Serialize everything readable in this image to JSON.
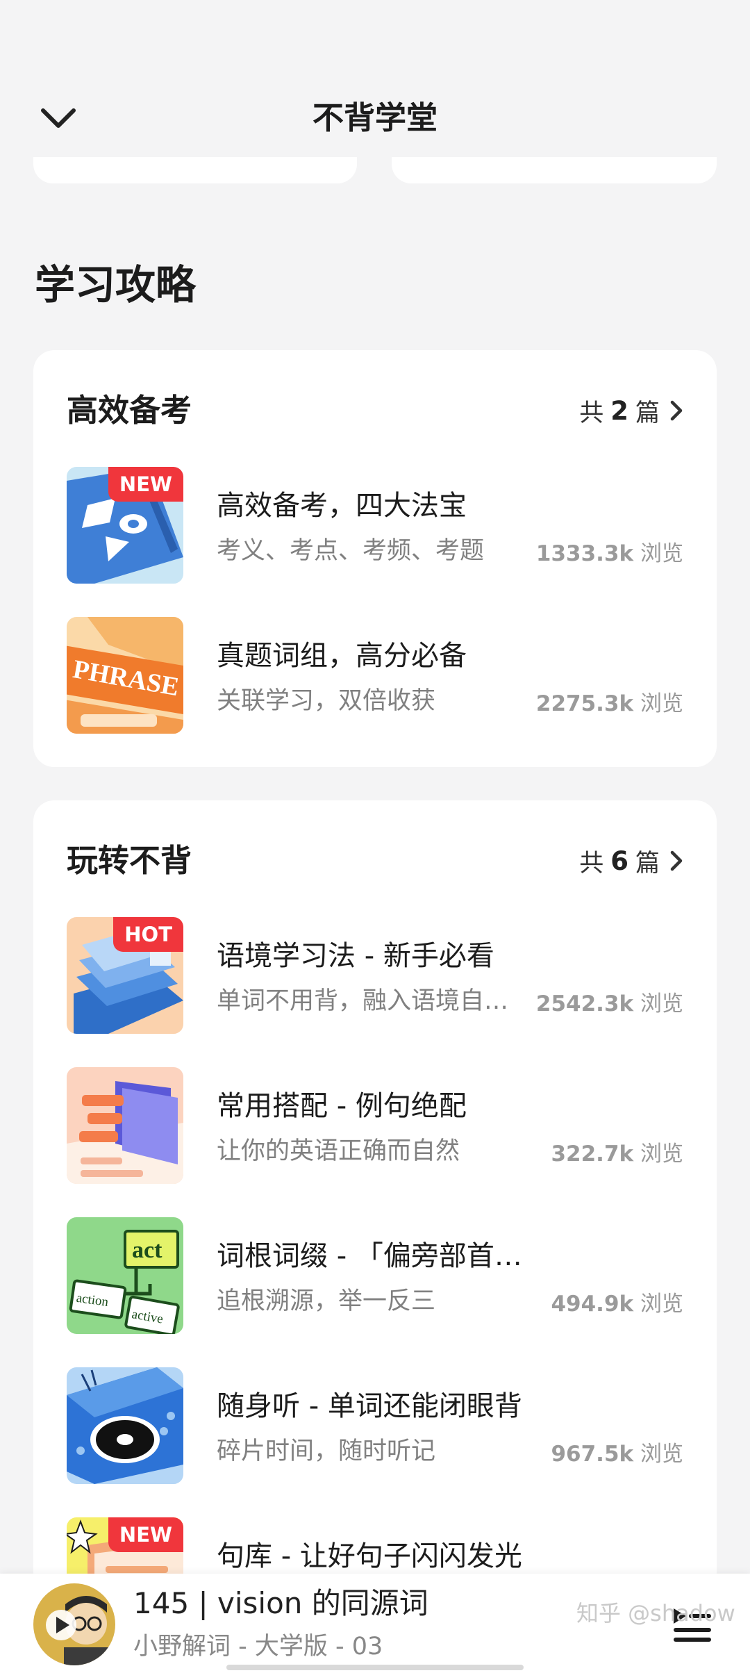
{
  "header": {
    "title": "不背学堂"
  },
  "section": {
    "title": "学习攻略"
  },
  "cards": [
    {
      "title": "高效备考",
      "count_prefix": "共",
      "count_num": "2",
      "count_suffix": "篇",
      "items": [
        {
          "title": "高效备考，四大法宝",
          "subtitle": "考义、考点、考频、考题",
          "views": "1333.3k",
          "badge": "NEW"
        },
        {
          "title": "真题词组，高分必备",
          "subtitle": "关联学习，双倍收获",
          "views": "2275.3k",
          "badge": ""
        }
      ]
    },
    {
      "title": "玩转不背",
      "count_prefix": "共",
      "count_num": "6",
      "count_suffix": "篇",
      "items": [
        {
          "title": "语境学习法 - 新手必看",
          "subtitle": "单词不用背，融入语境自…",
          "views": "2542.3k",
          "badge": "HOT"
        },
        {
          "title": "常用搭配 - 例句绝配",
          "subtitle": "让你的英语正确而自然",
          "views": "322.7k",
          "badge": ""
        },
        {
          "title": "词根词缀 - 「偏旁部首…",
          "subtitle": "追根溯源，举一反三",
          "views": "494.9k",
          "badge": ""
        },
        {
          "title": "随身听 - 单词还能闭眼背",
          "subtitle": "碎片时间，随时听记",
          "views": "967.5k",
          "badge": ""
        },
        {
          "title": "句库 - 让好句子闪闪发光",
          "subtitle": "",
          "views": "",
          "badge": "NEW"
        }
      ]
    }
  ],
  "views_unit": "浏览",
  "thumb_texts": {
    "phrase": "PHRASE",
    "act": "act",
    "action": "action",
    "active": "active"
  },
  "player": {
    "title": "145 | vision 的同源词",
    "subtitle": "小野解词 - 大学版 - 03"
  },
  "watermark": "知乎 @shadow",
  "colors": {
    "background": "#f4f4f5",
    "badge": "#f0363c",
    "card": "#ffffff"
  }
}
